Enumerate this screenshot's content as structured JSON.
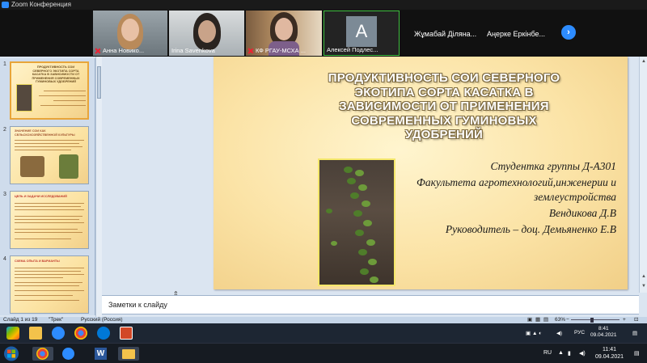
{
  "zoom": {
    "window_title": "Zoom Конференция",
    "participants": [
      {
        "name": "Анна Новико..."
      },
      {
        "name": "Irina Savenkova"
      },
      {
        "name": "КФ РГАУ-МСХА ..."
      },
      {
        "name": "Алексей Подлес...",
        "avatar_letter": "A"
      },
      {
        "name": "Жұмабай Діляна..."
      },
      {
        "name": "Аңерке Еркінбе..."
      }
    ],
    "next_icon": "chevron-right-icon",
    "colors": {
      "accent": "#2d8cff",
      "muted_mic": "#e22233"
    }
  },
  "ppt": {
    "thumbnails": [
      {
        "num": "1",
        "title": "ПРОДУКТИВНОСТЬ СОИ СЕВЕРНОГО ЭКОТИПА СОРТА КАСАТКА В ЗАВИСИМОСТИ ОТ ПРИМЕНЕНИЯ СОВРЕМЕННЫХ ГУМИНОВЫХ УДОБРЕНИЙ"
      },
      {
        "num": "2",
        "title": "ЗНАЧЕНИЕ СОИ КАК СЕЛЬСКОХОЗЯЙСТВЕННОЙ КУЛЬТУРЫ"
      },
      {
        "num": "3",
        "title": "ЦЕЛЬ И ЗАДАЧИ ИССЛЕДОВАНИЙ"
      },
      {
        "num": "4",
        "title": "СХЕМА ОПЫТА И ВАРИАНТЫ"
      }
    ],
    "slide": {
      "title_lines": [
        "ПРОДУКТИВНОСТЬ СОИ СЕВЕРНОГО",
        "ЭКОТИПА СОРТА КАСАТКА В",
        "ЗАВИСИМОСТИ ОТ ПРИМЕНЕНИЯ",
        "СОВРЕМЕННЫХ ГУМИНОВЫХ",
        "УДОБРЕНИЙ"
      ],
      "student_line": "Студентка группы Д-А301",
      "faculty_line1": "Факультета агротехнологий,инженерии и",
      "faculty_line2": "землеустройства",
      "author": "Вендикова Д.В",
      "supervisor": "Руководитель – доц. Демьяненко Е.В"
    },
    "notes_placeholder": "Заметки к слайду",
    "status": {
      "slide_counter": "Слайд 1 из 19",
      "theme": "\"Трек\"",
      "language": "Русский (Россия)",
      "zoom_level": "63%"
    }
  },
  "remote_taskbar": {
    "lang": "РУС",
    "time": "8:41",
    "date": "09.04.2021"
  },
  "local_taskbar": {
    "lang": "RU",
    "time": "11:41",
    "date": "09.04.2021"
  }
}
